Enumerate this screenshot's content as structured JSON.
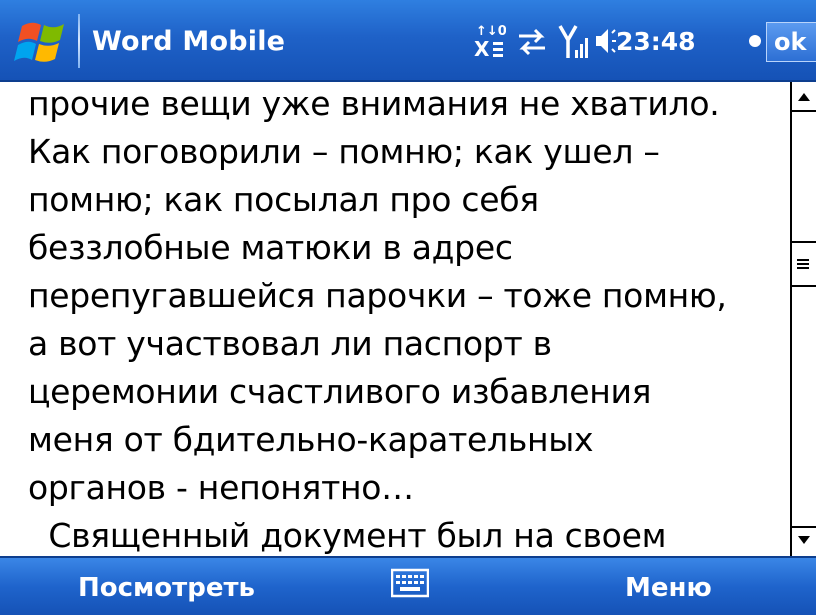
{
  "titlebar": {
    "app_title": "Word Mobile",
    "clock": "23:48",
    "ok_label": "ok",
    "icons": [
      "windows-start-icon",
      "data-connection-icon",
      "sync-arrows-icon",
      "signal-strength-icon",
      "speaker-volume-icon"
    ],
    "background": "#1f62c8"
  },
  "document": {
    "lines": [
      "прочие вещи уже внимания не хватило.",
      "Как поговорили – помню; как ушел –",
      "помню; как посылал про себя",
      "беззлобные матюки в адрес",
      "перепугавшейся парочки – тоже помню,",
      "а вот участвовал ли паспорт в",
      "церемонии счастливого избавления",
      "меня от бдительно-карательных",
      "органов - непонятно…",
      "  Священный документ был на своем"
    ]
  },
  "scrollbar": {
    "position_fraction": 0.35
  },
  "softbar": {
    "left_label": "Посмотреть",
    "right_label": "Меню",
    "center_icon": "keyboard-icon",
    "background": "#1f64cc"
  }
}
